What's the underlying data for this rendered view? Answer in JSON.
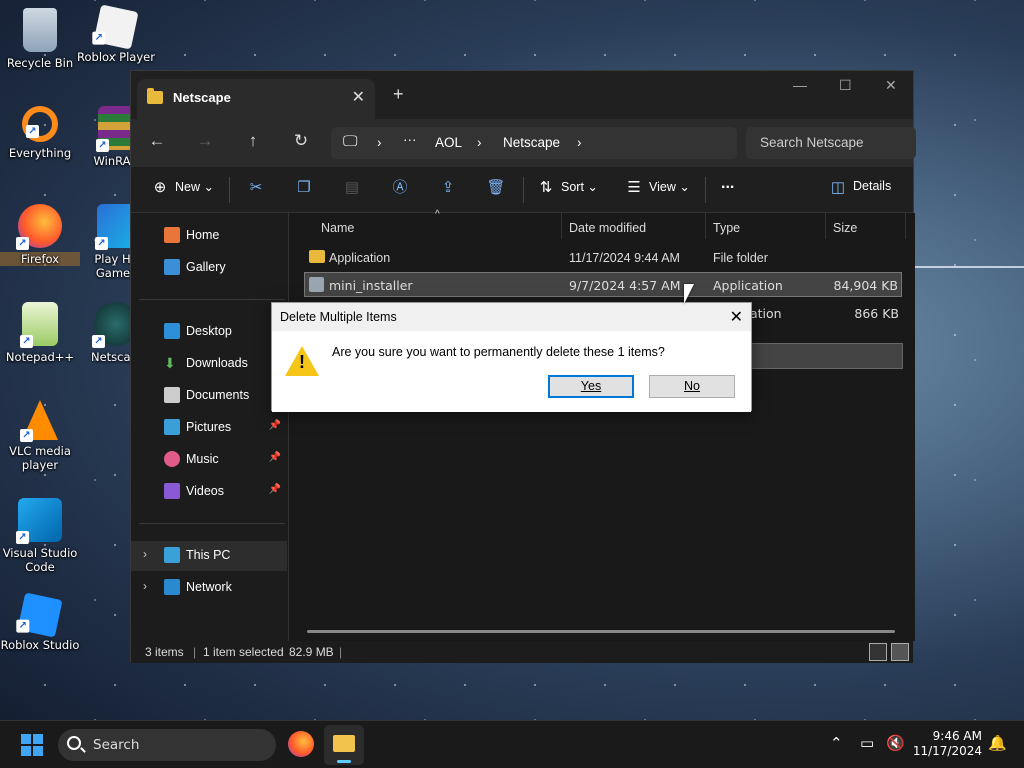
{
  "desktop": {
    "icons": [
      {
        "label": "Recycle Bin"
      },
      {
        "label": "Roblox Player"
      },
      {
        "label": "Everything"
      },
      {
        "label": "WinRAR"
      },
      {
        "label": "Firefox"
      },
      {
        "label": "Play HP Games"
      },
      {
        "label": "Notepad++"
      },
      {
        "label": "Netscape"
      },
      {
        "label": "VLC media player"
      },
      {
        "label": "Visual Studio Code"
      },
      {
        "label": "Roblox Studio"
      }
    ]
  },
  "explorer": {
    "tab_title": "Netscape",
    "new_tab": "+",
    "breadcrumb": [
      "AOL",
      "Netscape"
    ],
    "search_placeholder": "Search Netscape",
    "commands": {
      "new": "New",
      "sort": "Sort",
      "view": "View",
      "more": "...",
      "details": "Details"
    },
    "nav": {
      "home": "Home",
      "gallery": "Gallery",
      "desktop": "Desktop",
      "downloads": "Downloads",
      "documents": "Documents",
      "pictures": "Pictures",
      "music": "Music",
      "videos": "Videos",
      "this_pc": "This PC",
      "network": "Network"
    },
    "columns": {
      "name": "Name",
      "date": "Date modified",
      "type": "Type",
      "size": "Size"
    },
    "rows": [
      {
        "name": "Application",
        "date": "11/17/2024 9:44 AM",
        "type": "File folder",
        "size": ""
      },
      {
        "name": "mini_installer",
        "date": "9/7/2024 4:57 AM",
        "type": "Application",
        "size": "84,904 KB"
      },
      {
        "name": "",
        "date": "",
        "type": "ation",
        "size": "866 KB"
      }
    ],
    "status": {
      "items": "3 items",
      "selected": "1 item selected",
      "size": "82.9 MB"
    }
  },
  "dialog": {
    "title": "Delete Multiple Items",
    "message": "Are you sure you want to permanently delete these 1 items?",
    "yes": "Yes",
    "no": "No"
  },
  "taskbar": {
    "search": "Search",
    "time": "9:46 AM",
    "date": "11/17/2024"
  },
  "colors": {
    "accent": "#0078d7",
    "folder": "#e8b93a",
    "selection": "#444444"
  }
}
